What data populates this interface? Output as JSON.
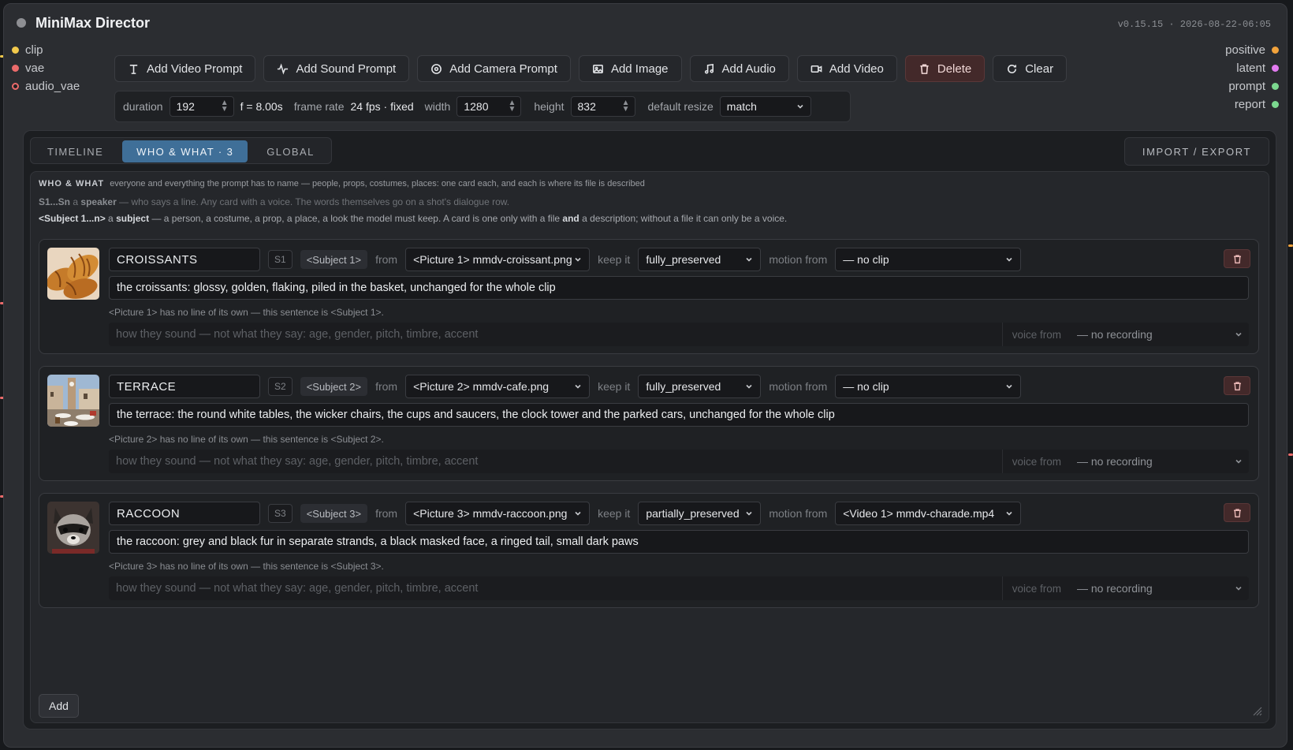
{
  "window": {
    "title": "MiniMax Director",
    "version": "v0.15.15 · 2026-08-22-06:05"
  },
  "inputs": [
    {
      "label": "clip",
      "color": "#f2c94c"
    },
    {
      "label": "vae",
      "color": "#eb6b6b"
    },
    {
      "label": "audio_vae",
      "color": "#eb6b6b"
    }
  ],
  "outputs": [
    {
      "label": "positive",
      "color": "#f2a33c"
    },
    {
      "label": "latent",
      "color": "#e27bf0"
    },
    {
      "label": "prompt",
      "color": "#7bd88f"
    },
    {
      "label": "report",
      "color": "#7bd88f"
    }
  ],
  "toolbar": {
    "add_video_prompt": "Add Video Prompt",
    "add_sound_prompt": "Add Sound Prompt",
    "add_camera_prompt": "Add Camera Prompt",
    "add_image": "Add Image",
    "add_audio": "Add Audio",
    "add_video": "Add Video",
    "delete": "Delete",
    "clear": "Clear"
  },
  "params": {
    "duration_label": "duration",
    "duration_value": "192",
    "duration_suffix": "f = 8.00s",
    "frame_rate_label": "frame rate",
    "frame_rate_value": "24 fps · fixed",
    "width_label": "width",
    "width_value": "1280",
    "height_label": "height",
    "height_value": "832",
    "resize_label": "default resize",
    "resize_value": "match"
  },
  "tabs": {
    "timeline": "TIMELINE",
    "who_what": "WHO & WHAT · 3",
    "global": "GLOBAL",
    "import_export": "IMPORT / EXPORT"
  },
  "help": {
    "heading": "WHO & WHAT",
    "line1": "everyone and everything the prompt has to name — people, props, costumes, places: one card each, and each is where its file is described",
    "speaker_token": "S1...Sn",
    "speaker_a": "a",
    "speaker_word": "speaker",
    "speaker_text": "— who says a line. Any card with a voice. The words themselves go on a shot's dialogue row.",
    "subject_token": "<Subject 1...n>",
    "subject_a": "a",
    "subject_word": "subject",
    "subject_text1": "— a person, a costume, a prop, a place, a look the model must keep. A card is one only with a file",
    "subject_and": "and",
    "subject_text2": "a description; without a file it can only be a voice."
  },
  "labels": {
    "from": "from",
    "keep_it": "keep it",
    "motion_from": "motion from",
    "voice_placeholder": "how they sound — not what they say: age, gender, pitch, timbre, accent",
    "voice_from": "voice from",
    "add": "Add"
  },
  "cards": [
    {
      "name": "CROISSANTS",
      "speaker": "S1",
      "subject": "<Subject 1>",
      "source": "<Picture 1> mmdv-croissant.png",
      "keep": "fully_preserved",
      "motion": "— no clip",
      "description": "the croissants: glossy, golden, flaking, piled in the basket, unchanged for the whole clip",
      "note": "<Picture 1> has no line of its own — this sentence is <Subject 1>.",
      "voice": "— no recording"
    },
    {
      "name": "TERRACE",
      "speaker": "S2",
      "subject": "<Subject 2>",
      "source": "<Picture 2> mmdv-cafe.png",
      "keep": "fully_preserved",
      "motion": "— no clip",
      "description": "the terrace: the round white tables, the wicker chairs, the cups and saucers, the clock tower and the parked cars, unchanged for the whole clip",
      "note": "<Picture 2> has no line of its own — this sentence is <Subject 2>.",
      "voice": "— no recording"
    },
    {
      "name": "RACCOON",
      "speaker": "S3",
      "subject": "<Subject 3>",
      "source": "<Picture 3> mmdv-raccoon.png",
      "keep": "partially_preserved",
      "motion": "<Video 1> mmdv-charade.mp4",
      "description": "the raccoon: grey and black fur in separate strands, a black masked face, a ringed tail, small dark paws",
      "note": "<Picture 3> has no line of its own — this sentence is <Subject 3>.",
      "voice": "— no recording"
    }
  ]
}
